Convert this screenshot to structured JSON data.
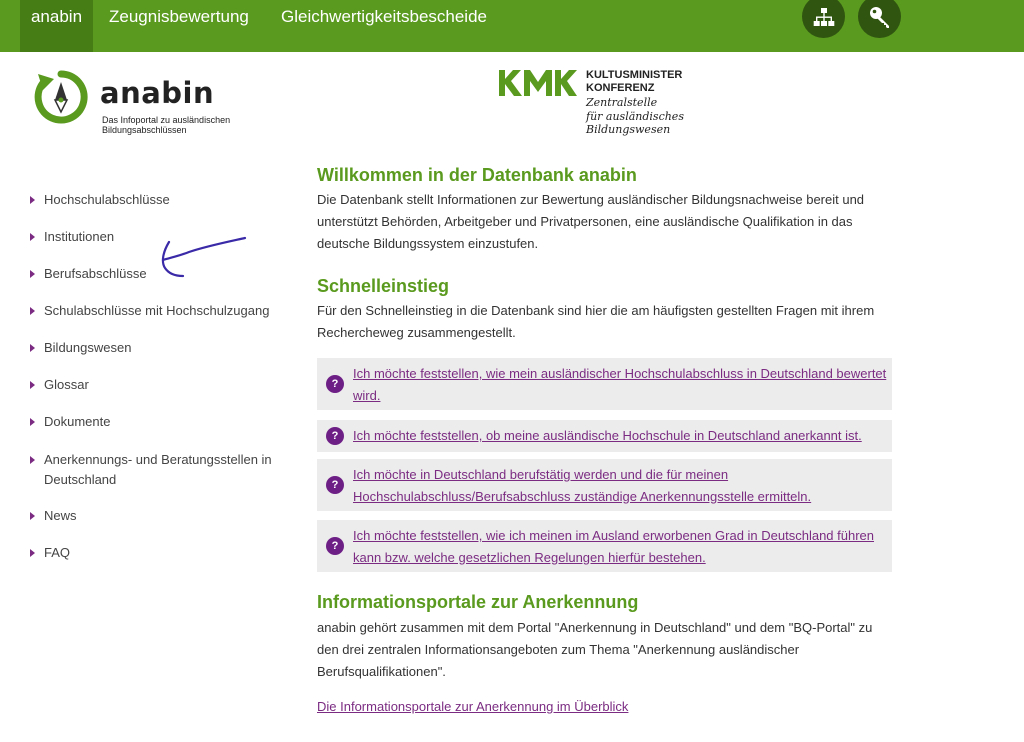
{
  "colors": {
    "brand_green": "#5a9a1e",
    "nav_active": "#477d15",
    "round_button": "#2f5510",
    "link_purple": "#7b2c82",
    "question_icon": "#6e1f86",
    "box_gray": "#ececec"
  },
  "topnav": {
    "items": [
      "anabin",
      "Zeugnisbewertung",
      "Gleichwertigkeitsbescheide"
    ],
    "sitemap_icon": "sitemap-icon",
    "login_icon": "key-icon"
  },
  "logo": {
    "word": "anabin",
    "subtitle": "Das Infoportal zu ausländischen Bildungsabschlüssen"
  },
  "kmk": {
    "letters": "KMK",
    "line1": "KULTUSMINISTER",
    "line2": "KONFERENZ",
    "italic1": "Zentralstelle",
    "italic2": "für ausländisches",
    "italic3": "Bildungswesen"
  },
  "sidebar": {
    "items": [
      "Hochschulabschlüsse",
      "Institutionen",
      "Berufsabschlüsse",
      "Schulabschlüsse mit Hochschulzugang",
      "Bildungswesen",
      "Glossar",
      "Dokumente",
      "Anerkennungs- und Beratungsstellen in Deutschland",
      "News",
      "FAQ"
    ]
  },
  "welcome": {
    "title": "Willkommen in der Datenbank anabin",
    "text": "Die Datenbank stellt Informationen zur Bewertung ausländischer Bildungsnachweise bereit und unterstützt Behörden, Arbeitgeber und Privatpersonen, eine ausländische Qualifikation in das deutsche Bildungssystem einzustufen."
  },
  "schnell": {
    "title": "Schnelleinstieg",
    "text": "Für den Schnelleinstieg in die Datenbank sind hier die am häufigsten gestellten Fragen mit ihrem Rechercheweg zusammengestellt.",
    "icon_glyph": "?",
    "questions": [
      "Ich möchte feststellen, wie mein ausländischer Hochschulabschluss in Deutschland bewertet wird.",
      "Ich möchte feststellen, ob meine ausländische Hochschule in Deutschland anerkannt ist.",
      "Ich möchte in Deutschland berufstätig werden und die für meinen Hochschulabschluss/Berufsabschluss zuständige Anerkennungsstelle ermitteln.",
      "Ich möchte feststellen, wie ich meinen im Ausland erworbenen Grad in Deutschland führen kann bzw. welche gesetzlichen Regelungen hierfür bestehen."
    ]
  },
  "portale": {
    "title": "Informationsportale zur Anerkennung",
    "text": "anabin gehört zusammen mit dem Portal \"Anerkennung in Deutschland\" und dem \"BQ-Portal\" zu den drei zentralen Informationsangeboten zum Thema \"Anerkennung ausländischer Berufsqualifikationen\".",
    "link": "Die Informationsportale zur Anerkennung im Überblick"
  }
}
